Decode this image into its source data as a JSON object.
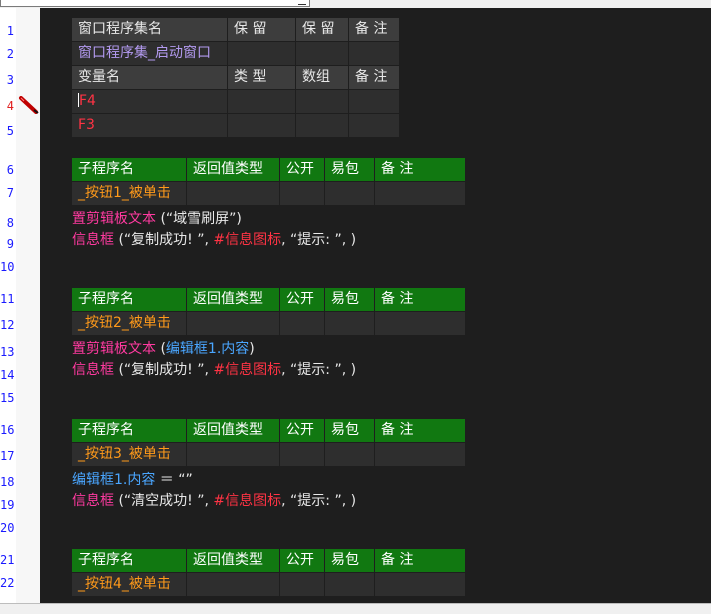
{
  "program_table": {
    "header": [
      "窗口程序集名",
      "保 留",
      "保 留",
      "备 注"
    ],
    "row": [
      "窗口程序集_启动窗口",
      "",
      "",
      ""
    ]
  },
  "var_table": {
    "header": [
      "变量名",
      "类 型",
      "数组",
      "备 注"
    ],
    "rows": [
      [
        "F4",
        "",
        "",
        ""
      ],
      [
        "F3",
        "",
        "",
        ""
      ]
    ]
  },
  "sub_header": [
    "子程序名",
    "返回值类型",
    "公开",
    "易包",
    "备 注"
  ],
  "subs": [
    {
      "name": "_按钮1_被单击",
      "lines": [
        [
          {
            "t": "置剪辑板文本",
            "c": "pink"
          },
          {
            "t": " (“域雪刷屏”)",
            "c": "white"
          }
        ],
        [
          {
            "t": "信息框",
            "c": "pink"
          },
          {
            "t": " (“复制成功! ”, ",
            "c": "white"
          },
          {
            "t": "#信息图标",
            "c": "red"
          },
          {
            "t": ", “提示: ”, )",
            "c": "white"
          }
        ]
      ]
    },
    {
      "name": "_按钮2_被单击",
      "lines": [
        [
          {
            "t": "置剪辑板文本",
            "c": "pink"
          },
          {
            "t": " (",
            "c": "white"
          },
          {
            "t": "编辑框1.内容",
            "c": "blue"
          },
          {
            "t": ")",
            "c": "white"
          }
        ],
        [
          {
            "t": "信息框",
            "c": "pink"
          },
          {
            "t": " (“复制成功! ”, ",
            "c": "white"
          },
          {
            "t": "#信息图标",
            "c": "red"
          },
          {
            "t": ", “提示: ”, )",
            "c": "white"
          }
        ]
      ]
    },
    {
      "name": "_按钮3_被单击",
      "lines": [
        [
          {
            "t": "编辑框1.内容",
            "c": "blue"
          },
          {
            "t": " ＝ “”",
            "c": "white"
          }
        ],
        [
          {
            "t": "信息框",
            "c": "pink"
          },
          {
            "t": " (“清空成功! ”, ",
            "c": "white"
          },
          {
            "t": "#信息图标",
            "c": "red"
          },
          {
            "t": ", “提示: ”, )",
            "c": "white"
          }
        ]
      ]
    },
    {
      "name": "_按钮4_被单击",
      "lines": []
    }
  ],
  "line_numbers": [
    "1",
    "2",
    "3",
    "4",
    "5",
    "6",
    "7",
    "8",
    "9",
    "10",
    "11",
    "12",
    "13",
    "14",
    "15",
    "16",
    "17",
    "18",
    "19",
    "20",
    "21",
    "22"
  ],
  "active_line": "4",
  "colors": {
    "accent_green": "#117811",
    "header_gray": "#3d3d3d",
    "background": "#1e1e1e"
  }
}
